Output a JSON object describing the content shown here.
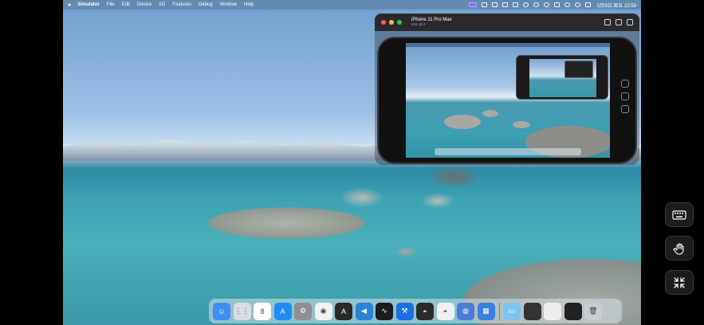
{
  "menubar": {
    "apple_icon": "apple-icon",
    "items": [
      "Simulator",
      "File",
      "Edit",
      "Device",
      "I/O",
      "Features",
      "Debug",
      "Window",
      "Help"
    ],
    "clock": "5月9日 周五  22:59"
  },
  "simulator": {
    "device_name": "iPhone 11 Pro Max",
    "os_version": "iOS 18.2"
  },
  "dock": {
    "apps": [
      {
        "icon": "finder-icon",
        "color": "#3f8ef0",
        "glyph": "☺"
      },
      {
        "icon": "launchpad-icon",
        "color": "#d9dde3",
        "glyph": "⋮⋮"
      },
      {
        "icon": "calendar-icon",
        "color": "#ffffff",
        "glyph": "8"
      },
      {
        "icon": "app-store-icon",
        "color": "#1e8cf3",
        "glyph": "A"
      },
      {
        "icon": "system-settings-icon",
        "color": "#8e8e93",
        "glyph": "⚙"
      },
      {
        "icon": "chrome-icon",
        "color": "#f2f2f2",
        "glyph": "◉"
      },
      {
        "icon": "instruments-icon",
        "color": "#2a2a2a",
        "glyph": "A"
      },
      {
        "icon": "vscode-icon",
        "color": "#2a83d6",
        "glyph": "◀"
      },
      {
        "icon": "activity-monitor-icon",
        "color": "#1c1c1c",
        "glyph": "∿"
      },
      {
        "icon": "xcode-icon",
        "color": "#1b6fe0",
        "glyph": "⚒"
      },
      {
        "icon": "ufo-app-1-icon",
        "color": "#2b2b2b",
        "glyph": "◓"
      },
      {
        "icon": "ufo-app-2-icon",
        "color": "#f0f0f0",
        "glyph": "◓"
      },
      {
        "icon": "robot-app-icon",
        "color": "#4a7bd8",
        "glyph": "◍"
      },
      {
        "icon": "files-app-icon",
        "color": "#3b7fe0",
        "glyph": "▦"
      }
    ],
    "recents": [
      {
        "icon": "folder-icon",
        "color": "#7fc4f0",
        "glyph": "▭"
      },
      {
        "icon": "window-thumbnail-icon",
        "color": "#333333",
        "glyph": ""
      },
      {
        "icon": "window-thumbnail-icon",
        "color": "#eeeeee",
        "glyph": ""
      },
      {
        "icon": "window-thumbnail-icon",
        "color": "#222222",
        "glyph": ""
      },
      {
        "icon": "trash-icon",
        "color": "#c9cdd2",
        "glyph": "🗑"
      }
    ]
  }
}
